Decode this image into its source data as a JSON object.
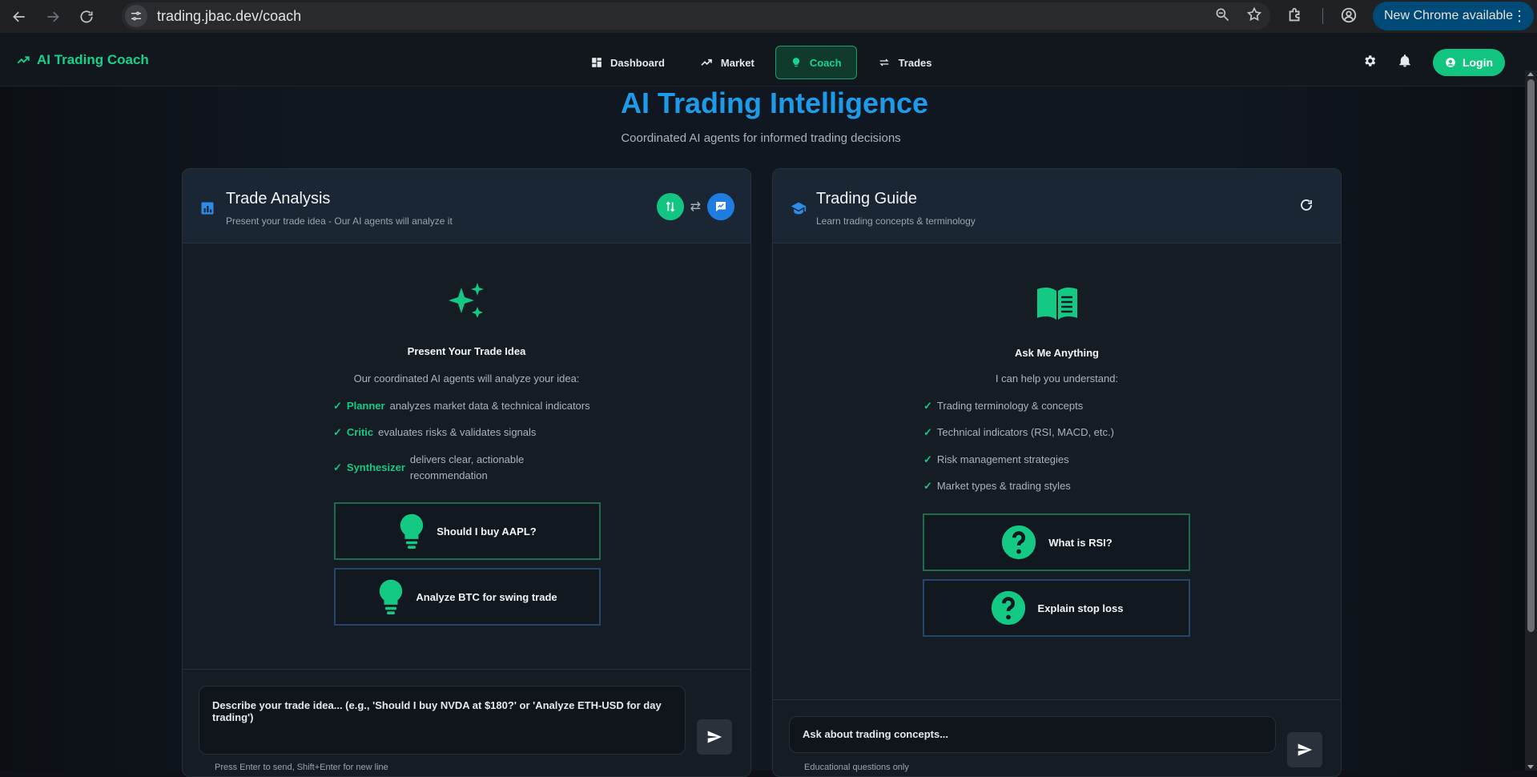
{
  "browser": {
    "url": "trading.jbac.dev/coach",
    "update_label": "New Chrome available"
  },
  "app": {
    "brand": "AI Trading Coach",
    "nav": [
      {
        "label": "Dashboard",
        "icon": "dashboard-icon"
      },
      {
        "label": "Market",
        "icon": "trending-icon"
      },
      {
        "label": "Coach",
        "icon": "lightbulb-icon",
        "active": true
      },
      {
        "label": "Trades",
        "icon": "swap-icon"
      }
    ],
    "login_label": "Login"
  },
  "hero": {
    "title": "AI Trading Intelligence",
    "subtitle": "Coordinated AI agents for informed trading decisions"
  },
  "analysis": {
    "title": "Trade Analysis",
    "subtitle": "Present your trade idea - Our AI agents will analyze it",
    "heading": "Present Your Trade Idea",
    "intro": "Our coordinated AI agents will analyze your idea:",
    "features": [
      {
        "keyword": "Planner",
        "text": "analyzes market data & technical indicators"
      },
      {
        "keyword": "Critic",
        "text": "evaluates risks & validates signals"
      },
      {
        "keyword": "Synthesizer",
        "text": "delivers clear, actionable recommendation"
      }
    ],
    "suggestions": [
      "Should I buy AAPL?",
      "Analyze BTC for swing trade"
    ],
    "input_placeholder": "Describe your trade idea... (e.g., 'Should I buy NVDA at $180?' or 'Analyze ETH-USD for day trading')",
    "hint": "Press Enter to send, Shift+Enter for new line"
  },
  "guide": {
    "title": "Trading Guide",
    "subtitle": "Learn trading concepts & terminology",
    "heading": "Ask Me Anything",
    "intro": "I can help you understand:",
    "features": [
      "Trading terminology & concepts",
      "Technical indicators (RSI, MACD, etc.)",
      "Risk management strategies",
      "Market types & trading styles"
    ],
    "suggestions": [
      "What is RSI?",
      "Explain stop loss"
    ],
    "input_placeholder": "Ask about trading concepts...",
    "hint": "Educational questions only"
  },
  "colors": {
    "accent_green": "#14c983",
    "accent_blue": "#1e9be8",
    "background": "#111720"
  }
}
